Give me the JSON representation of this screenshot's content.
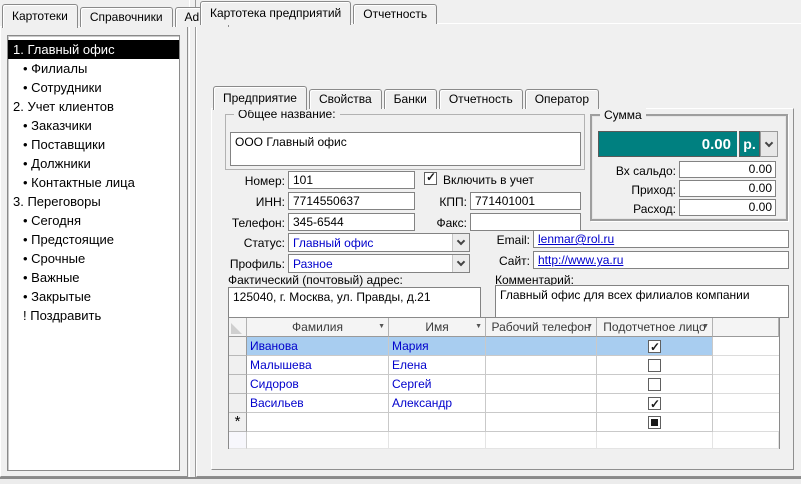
{
  "left_tabs": {
    "items": [
      {
        "label": "Картотеки"
      },
      {
        "label": "Справочники"
      },
      {
        "label": "Admin"
      }
    ],
    "active_index": 0
  },
  "right_tabs": {
    "items": [
      {
        "label": "Картотека предприятий"
      },
      {
        "label": "Отчетность"
      }
    ],
    "active_index": 0
  },
  "tree": {
    "items": [
      {
        "label": "1. Главный офис",
        "selected": true
      },
      {
        "label": "• Филиалы"
      },
      {
        "label": "• Сотрудники"
      },
      {
        "label": "2. Учет клиентов"
      },
      {
        "label": "• Заказчики"
      },
      {
        "label": "• Поставщики"
      },
      {
        "label": "• Должники"
      },
      {
        "label": "• Контактные лица"
      },
      {
        "label": "3. Переговоры"
      },
      {
        "label": "• Сегодня"
      },
      {
        "label": "• Предстоящие"
      },
      {
        "label": "• Срочные"
      },
      {
        "label": "• Важные"
      },
      {
        "label": "• Закрытые"
      },
      {
        "label": "! Поздравить"
      }
    ]
  },
  "inner_tabs": {
    "items": [
      {
        "label": "Предприятие"
      },
      {
        "label": "Свойства"
      },
      {
        "label": "Банки"
      },
      {
        "label": "Отчетность"
      },
      {
        "label": "Оператор"
      }
    ],
    "active_index": 0
  },
  "form": {
    "name_group": {
      "label": "Общее название:",
      "value": "ООО Главный офис"
    },
    "nomer": {
      "label": "Номер:",
      "value": "101"
    },
    "include": {
      "label": "Включить в учет",
      "checked": true
    },
    "inn": {
      "label": "ИНН:",
      "value": "7714550637"
    },
    "kpp": {
      "label": "КПП:",
      "value": "771401001"
    },
    "phone": {
      "label": "Телефон:",
      "value": "345-6544"
    },
    "fax": {
      "label": "Факс:",
      "value": ""
    },
    "status": {
      "label": "Статус:",
      "value": "Главный офис"
    },
    "profile": {
      "label": "Профиль:",
      "value": "Разное"
    },
    "email": {
      "label": "Email:",
      "value": "lenmar@rol.ru"
    },
    "site": {
      "label": "Сайт:",
      "value": "http://www.ya.ru"
    },
    "address": {
      "label": "Фактический (почтовый) адрес:",
      "value": "125040, г. Москва, ул. Правды, д.21"
    },
    "comment": {
      "label": "Комментарий:",
      "value": "Главный офис для всех филиалов компании"
    }
  },
  "summa": {
    "label": "Сумма",
    "total": "0.00",
    "currency": "р.",
    "fields": [
      {
        "label": "Вх сальдо:",
        "value": "0.00"
      },
      {
        "label": "Приход:",
        "value": "0.00"
      },
      {
        "label": "Расход:",
        "value": "0.00"
      }
    ]
  },
  "table": {
    "columns": [
      "Фамилия",
      "Имя",
      "Рабочий телефон",
      "Подотчетное лицо"
    ],
    "rows": [
      {
        "lastname": "Иванова",
        "firstname": "Мария",
        "phone": "",
        "accountable": true,
        "selected": true
      },
      {
        "lastname": "Малышева",
        "firstname": "Елена",
        "phone": "",
        "accountable": false,
        "selected": false
      },
      {
        "lastname": "Сидоров",
        "firstname": "Сергей",
        "phone": "",
        "accountable": false,
        "selected": false
      },
      {
        "lastname": "Васильев",
        "firstname": "Александр",
        "phone": "",
        "accountable": true,
        "selected": false
      }
    ],
    "new_row_marker": "*"
  },
  "colors": {
    "accent_teal": "#008080",
    "selection_black": "#000000",
    "row_selected_blue": "#a8cdf0",
    "link_blue": "#0000cc",
    "window_bg": "#f0f0f0"
  }
}
